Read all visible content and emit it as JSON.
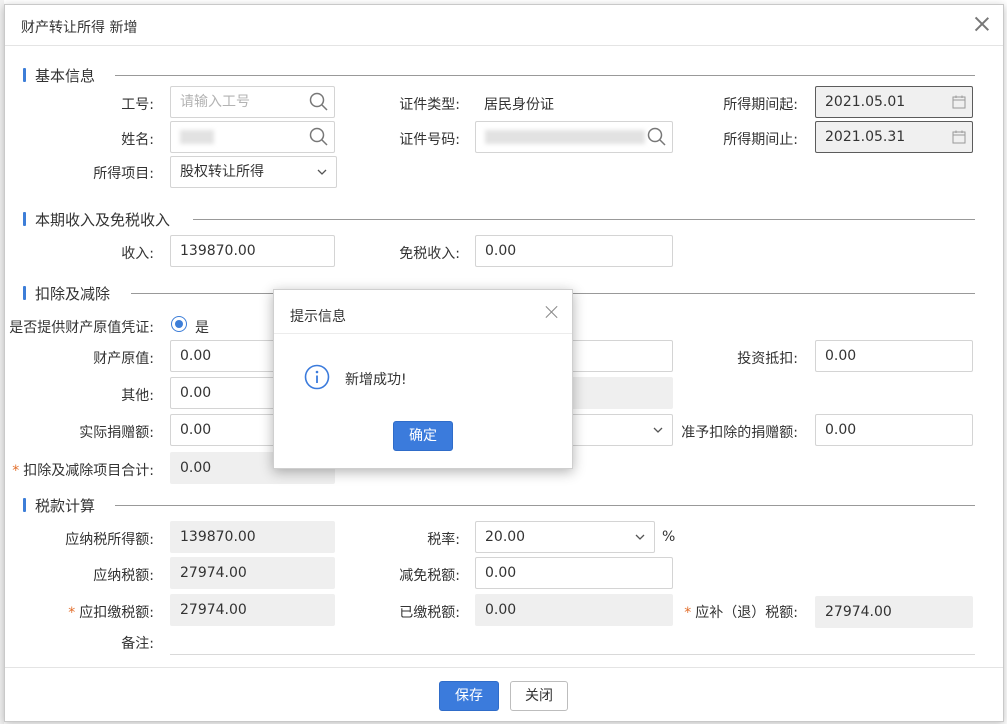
{
  "dialog": {
    "title": "财产转让所得 新增"
  },
  "sections": {
    "basic": "基本信息",
    "income": "本期收入及免税收入",
    "deduction": "扣除及减除",
    "tax": "税款计算"
  },
  "basic": {
    "emp_id_label": "工号:",
    "emp_id_placeholder": "请输入工号",
    "cert_type_label": "证件类型:",
    "cert_type_value": "居民身份证",
    "period_start_label": "所得期间起:",
    "period_start_value": "2021.05.01",
    "name_label": "姓名:",
    "cert_no_label": "证件号码:",
    "period_end_label": "所得期间止:",
    "period_end_value": "2021.05.31",
    "income_item_label": "所得项目:",
    "income_item_value": "股权转让所得"
  },
  "income": {
    "income_label": "收入:",
    "income_value": "139870.00",
    "exempt_label": "免税收入:",
    "exempt_value": "0.00"
  },
  "deduction": {
    "provide_label": "是否提供财产原值凭证:",
    "provide_option": "是",
    "original_label": "财产原值:",
    "original_value": "0.00",
    "invest_label": "投资抵扣:",
    "invest_value": "0.00",
    "other_label": "其他:",
    "other_value": "0.00",
    "donation_label": "实际捐赠额:",
    "donation_value": "0.00",
    "allowed_donation_label": "准予扣除的捐赠额:",
    "allowed_donation_value": "0.00",
    "total_label": "扣除及减除项目合计:",
    "total_value": "0.00"
  },
  "tax": {
    "taxable_label": "应纳税所得额:",
    "taxable_value": "139870.00",
    "rate_label": "税率:",
    "rate_value": "20.00",
    "rate_unit": "%",
    "payable_label": "应纳税额:",
    "payable_value": "27974.00",
    "relief_label": "减免税额:",
    "relief_value": "0.00",
    "withhold_label": "应扣缴税额:",
    "withhold_value": "27974.00",
    "paid_label": "已缴税额:",
    "paid_value": "0.00",
    "refund_label": "应补（退）税额:",
    "refund_value": "27974.00",
    "remark_label": "备注:"
  },
  "footer": {
    "save": "保存",
    "close": "关闭"
  },
  "popup": {
    "title": "提示信息",
    "message": "新增成功!",
    "confirm": "确定"
  },
  "colors": {
    "accent": "#3b7bdc",
    "required": "#e26d2a"
  }
}
